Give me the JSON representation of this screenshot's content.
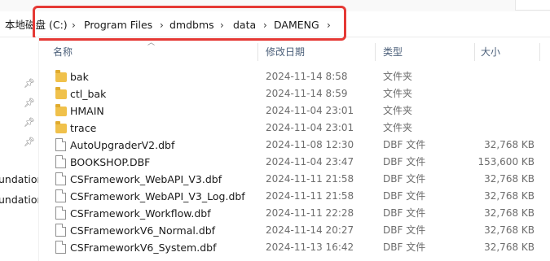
{
  "address": {
    "crumbs": [
      "本地磁盘 (C:)",
      "Program Files",
      "dmdbms",
      "data",
      "DAMENG"
    ],
    "separator": "›"
  },
  "nav": {
    "items": [
      "undation",
      "undation"
    ]
  },
  "header": {
    "name": "名称",
    "date": "修改日期",
    "type": "类型",
    "size": "大小"
  },
  "files": [
    {
      "name": "bak",
      "date": "2024-11-14 8:58",
      "type": "文件夹",
      "size": "",
      "kind": "folder"
    },
    {
      "name": "ctl_bak",
      "date": "2024-11-14 8:59",
      "type": "文件夹",
      "size": "",
      "kind": "folder"
    },
    {
      "name": "HMAIN",
      "date": "2024-11-04 23:01",
      "type": "文件夹",
      "size": "",
      "kind": "folder"
    },
    {
      "name": "trace",
      "date": "2024-11-04 23:01",
      "type": "文件夹",
      "size": "",
      "kind": "folder"
    },
    {
      "name": "AutoUpgraderV2.dbf",
      "date": "2024-11-08 12:30",
      "type": "DBF 文件",
      "size": "32,768 KB",
      "kind": "file"
    },
    {
      "name": "BOOKSHOP.DBF",
      "date": "2024-11-04 23:47",
      "type": "DBF 文件",
      "size": "153,600 KB",
      "kind": "file"
    },
    {
      "name": "CSFramework_WebAPI_V3.dbf",
      "date": "2024-11-11 21:58",
      "type": "DBF 文件",
      "size": "32,768 KB",
      "kind": "file"
    },
    {
      "name": "CSFramework_WebAPI_V3_Log.dbf",
      "date": "2024-11-11 21:58",
      "type": "DBF 文件",
      "size": "32,768 KB",
      "kind": "file"
    },
    {
      "name": "CSFramework_Workflow.dbf",
      "date": "2024-11-11 22:28",
      "type": "DBF 文件",
      "size": "32,768 KB",
      "kind": "file"
    },
    {
      "name": "CSFrameworkV6_Normal.dbf",
      "date": "2024-11-14 20:27",
      "type": "DBF 文件",
      "size": "32,768 KB",
      "kind": "file"
    },
    {
      "name": "CSFrameworkV6_System.dbf",
      "date": "2024-11-13 16:42",
      "type": "DBF 文件",
      "size": "32,768 KB",
      "kind": "file"
    }
  ]
}
